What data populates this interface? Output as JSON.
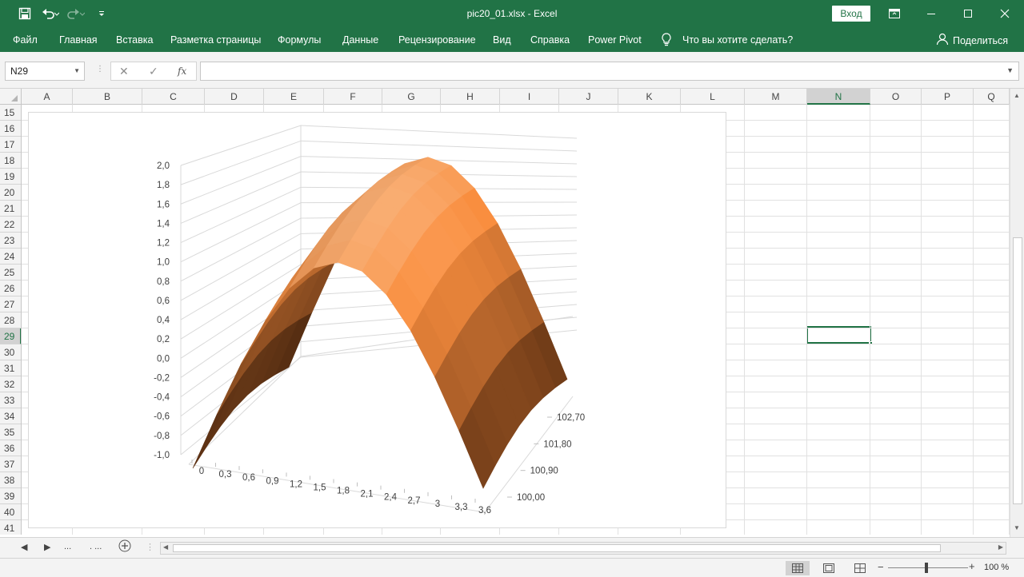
{
  "window": {
    "title": "pic20_01.xlsx  -  Excel",
    "signin_label": "Вход"
  },
  "ribbon": {
    "tabs": [
      "Файл",
      "Главная",
      "Вставка",
      "Разметка страницы",
      "Формулы",
      "Данные",
      "Рецензирование",
      "Вид",
      "Справка",
      "Power Pivot"
    ],
    "tell_me": "Что вы хотите сделать?",
    "share_label": "Поделиться"
  },
  "formula_bar": {
    "name_box": "N29",
    "fx_label": "fx",
    "value": ""
  },
  "grid": {
    "columns": [
      "A",
      "B",
      "C",
      "D",
      "E",
      "F",
      "G",
      "H",
      "I",
      "J",
      "K",
      "L",
      "M",
      "N",
      "O",
      "P",
      "Q"
    ],
    "rows": [
      "15",
      "16",
      "17",
      "18",
      "19",
      "20",
      "21",
      "22",
      "23",
      "24",
      "25",
      "26",
      "27",
      "28",
      "29",
      "30",
      "31",
      "32",
      "33",
      "34",
      "35",
      "36",
      "37",
      "38",
      "39",
      "40",
      "41"
    ],
    "selected_column": "N",
    "selected_row": "29"
  },
  "chart_data": {
    "type": "surface",
    "z_axis_ticks": [
      "2,0",
      "1,8",
      "1,6",
      "1,4",
      "1,2",
      "1,0",
      "0,8",
      "0,6",
      "0,4",
      "0,2",
      "0,0",
      "-0,2",
      "-0,4",
      "-0,6",
      "-0,8",
      "-1,0"
    ],
    "x_axis_ticks": [
      "0",
      "0,3",
      "0,6",
      "0,9",
      "1,2",
      "1,5",
      "1,8",
      "2,1",
      "2,4",
      "2,7",
      "3",
      "3,3",
      "3,6"
    ],
    "y_axis_ticks": [
      "100,00",
      "100,90",
      "101,80",
      "102,70"
    ],
    "zlim": [
      -1.0,
      2.0
    ],
    "grid": true,
    "colors": {
      "low": "#5b2f12",
      "mid": "#f58b3d",
      "high": "#fde4c8"
    }
  },
  "sheet_tabs": {
    "nav_more": "...",
    "tab_more": ". ..."
  },
  "status": {
    "zoom_label": "100 %"
  }
}
